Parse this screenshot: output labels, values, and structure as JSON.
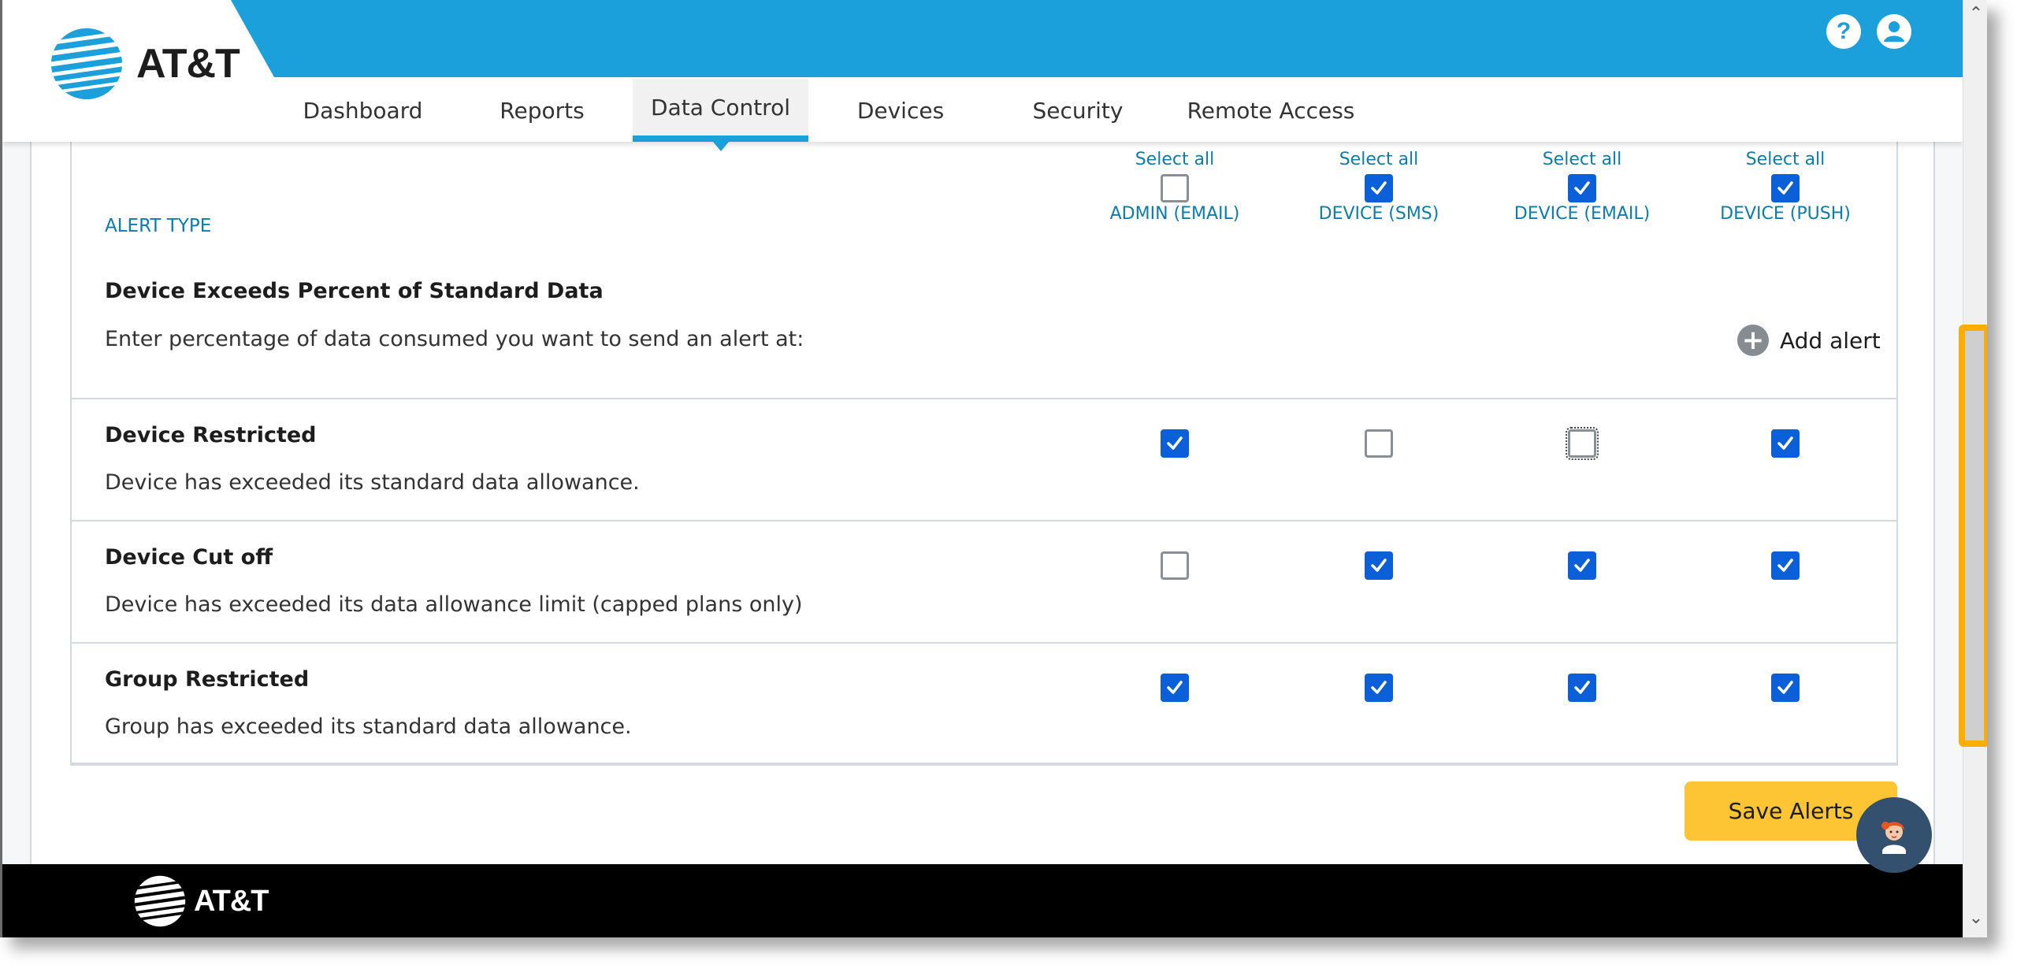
{
  "header": {
    "brand": "AT&T",
    "brand_color": "#1ba0db",
    "icons": [
      "help-icon",
      "account-icon"
    ],
    "help_glyph": "?",
    "nav_tabs": [
      {
        "label": "Dashboard",
        "active": false
      },
      {
        "label": "Reports",
        "active": false
      },
      {
        "label": "Data Control",
        "active": true
      },
      {
        "label": "Devices",
        "active": false
      },
      {
        "label": "Security",
        "active": false
      },
      {
        "label": "Remote Access",
        "active": false
      }
    ]
  },
  "alerts_table": {
    "alert_type_label": "ALERT TYPE",
    "columns": [
      {
        "select_all_label": "Select all",
        "label": "ADMIN (EMAIL)",
        "select_all_checked": false
      },
      {
        "select_all_label": "Select all",
        "label": "DEVICE (SMS)",
        "select_all_checked": true
      },
      {
        "select_all_label": "Select all",
        "label": "DEVICE (EMAIL)",
        "select_all_checked": true
      },
      {
        "select_all_label": "Select all",
        "label": "DEVICE (PUSH)",
        "select_all_checked": true
      }
    ],
    "percent_section": {
      "title": "Device Exceeds Percent of Standard Data",
      "description": "Enter percentage of data consumed you want to send an alert at:",
      "add_alert_label": "Add alert"
    },
    "rows": [
      {
        "title": "Device Restricted",
        "description": "Device has exceeded its standard data allowance.",
        "checked": [
          true,
          false,
          false,
          true
        ],
        "focused_col": 2
      },
      {
        "title": "Device Cut off",
        "description": "Device has exceeded its data allowance limit (capped plans only)",
        "checked": [
          false,
          true,
          true,
          true
        ]
      },
      {
        "title": "Group Restricted",
        "description": "Group has exceeded its standard data allowance.",
        "checked": [
          true,
          true,
          true,
          true
        ]
      }
    ]
  },
  "actions": {
    "save_label": "Save Alerts",
    "save_color": "#fdc533"
  },
  "chat": {
    "icon": "chat-assistant-avatar-icon"
  },
  "footer": {
    "brand": "AT&T"
  },
  "colors": {
    "checkbox_checked": "#0b5fd8",
    "label_teal": "#0b7cab",
    "scroll_highlight": "#fcae00"
  }
}
